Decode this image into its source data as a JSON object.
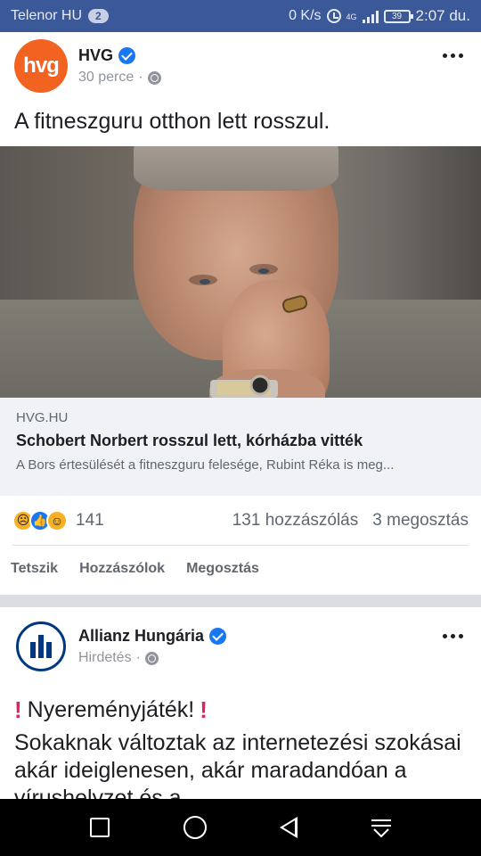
{
  "status_bar": {
    "carrier": "Telenor HU",
    "sim_badge": "2",
    "net_speed": "0 K/s",
    "net_type": "4G",
    "battery": "39",
    "time": "2:07 du."
  },
  "post1": {
    "author": "HVG",
    "avatar_text": "hvg",
    "time": "30 perce",
    "separator": "·",
    "text": "A fitneszguru otthon lett rosszul.",
    "link": {
      "domain": "HVG.HU",
      "title": "Schobert Norbert rosszul lett, kórházba vitték",
      "description": "A Bors értesülését a fitneszguru felesége, Rubint Réka is meg..."
    },
    "reactions": {
      "count": "141",
      "comments": "131 hozzászólás",
      "shares": "3 megosztás"
    },
    "actions": {
      "like": "Tetszik",
      "comment": "Hozzászólok",
      "share": "Megosztás"
    }
  },
  "post2": {
    "author": "Allianz Hungária",
    "time": "Hirdetés",
    "separator": "·",
    "headline": "Nyereményjáték!",
    "body": "Sokaknak változtak az internetezési szokásai akár ideiglenesen, akár maradandóan a vírushelyzet és a"
  },
  "colors": {
    "status_bar": "#3b5998",
    "hvg_orange": "#f26322",
    "allianz_blue": "#003781",
    "verified_blue": "#1877f2"
  }
}
